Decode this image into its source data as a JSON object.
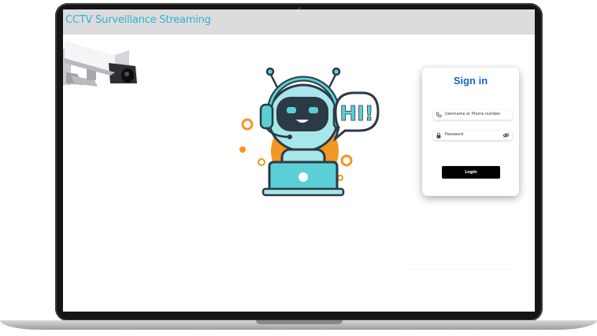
{
  "app": {
    "title": "CCTV Surveillance Streaming"
  },
  "illustration": {
    "speech_text": "HI!"
  },
  "signin": {
    "title": "Sign in",
    "username_placeholder": "Username or Phone number",
    "password_placeholder": "Password",
    "login_label": "Login"
  },
  "colors": {
    "title_text": "#2fb1d8",
    "header_bg": "#dcdcdc",
    "signin_title": "#1a63c9",
    "robot_teal": "#5ccfd6",
    "robot_orange": "#f39623",
    "button_bg": "#000000"
  },
  "icons": [
    "cctv-camera-icon",
    "robot-illustration",
    "phone-icon",
    "lock-icon",
    "eye-off-icon"
  ]
}
